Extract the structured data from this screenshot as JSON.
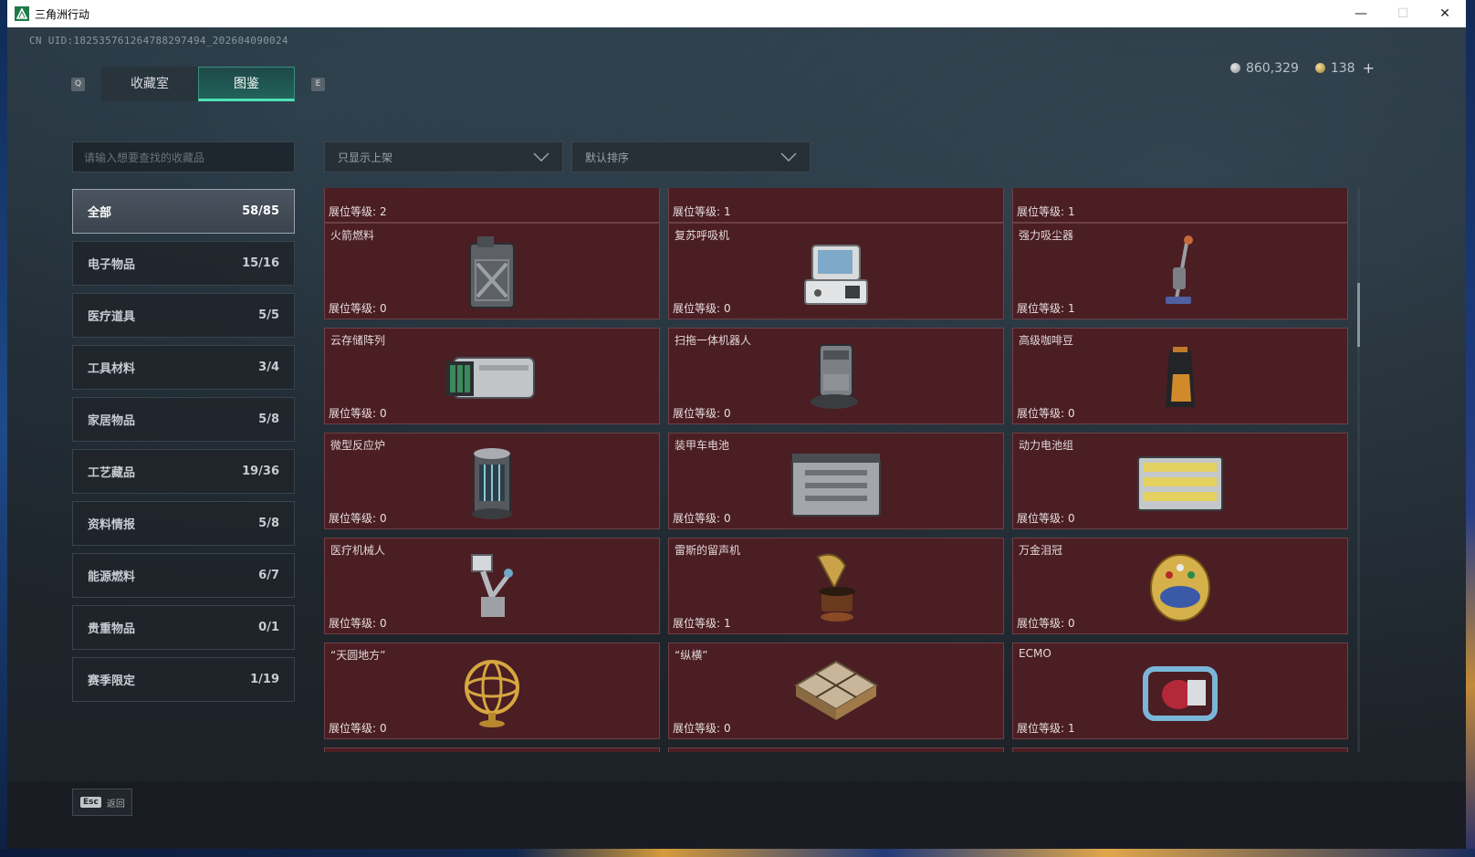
{
  "window": {
    "title": "三角洲行动",
    "minimize": "—",
    "maximize": "☐",
    "close": "✕"
  },
  "uid": "CN UID:18253576126478829749​4_202604090024",
  "currency": {
    "silver_amount": "860,329",
    "gold_amount": "138",
    "plus": "+"
  },
  "tabs": {
    "key_left": "Q",
    "key_right": "E",
    "items": [
      {
        "label": "收藏室"
      },
      {
        "label": "图鉴"
      }
    ]
  },
  "search": {
    "placeholder": "请输入想要查找的收藏品"
  },
  "filters": {
    "display_filter": "只显示上架",
    "sort": "默认排序"
  },
  "categories": [
    {
      "label": "全部",
      "count": "58/85"
    },
    {
      "label": "电子物品",
      "count": "15/16"
    },
    {
      "label": "医疗道具",
      "count": "5/5"
    },
    {
      "label": "工具材料",
      "count": "3/4"
    },
    {
      "label": "家居物品",
      "count": "5/8"
    },
    {
      "label": "工艺藏品",
      "count": "19/36"
    },
    {
      "label": "资料情报",
      "count": "5/8"
    },
    {
      "label": "能源燃料",
      "count": "6/7"
    },
    {
      "label": "贵重物品",
      "count": "0/1"
    },
    {
      "label": "赛季限定",
      "count": "1/19"
    }
  ],
  "level_label": "展位等级:",
  "items": [
    {
      "name": "",
      "level": "2",
      "icon": "partial-item-icon"
    },
    {
      "name": "",
      "level": "1",
      "icon": "partial-item-icon"
    },
    {
      "name": "",
      "level": "1",
      "icon": "partial-item-icon"
    },
    {
      "name": "火箭燃料",
      "level": "0",
      "icon": "rocket-fuel-icon"
    },
    {
      "name": "复苏呼吸机",
      "level": "0",
      "icon": "ventilator-icon"
    },
    {
      "name": "强力吸尘器",
      "level": "1",
      "icon": "vacuum-cleaner-icon"
    },
    {
      "name": "云存储阵列",
      "level": "0",
      "icon": "storage-array-icon"
    },
    {
      "name": "扫拖一体机器人",
      "level": "0",
      "icon": "mop-robot-icon"
    },
    {
      "name": "高级咖啡豆",
      "level": "0",
      "icon": "coffee-bean-icon"
    },
    {
      "name": "微型反应炉",
      "level": "0",
      "icon": "reactor-icon"
    },
    {
      "name": "装甲车电池",
      "level": "0",
      "icon": "vehicle-battery-icon"
    },
    {
      "name": "动力电池组",
      "level": "0",
      "icon": "battery-pack-icon"
    },
    {
      "name": "医疗机械人",
      "level": "0",
      "icon": "medical-robot-icon"
    },
    {
      "name": "雷斯的留声机",
      "level": "1",
      "icon": "gramophone-icon"
    },
    {
      "name": "万金泪冠",
      "level": "0",
      "icon": "jeweled-egg-icon"
    },
    {
      "name": "“天圆地方”",
      "level": "0",
      "icon": "armillary-sphere-icon"
    },
    {
      "name": "“纵横”",
      "level": "0",
      "icon": "chessboard-icon"
    },
    {
      "name": "ECMO",
      "level": "1",
      "icon": "ecmo-icon"
    }
  ],
  "footer": {
    "esc_key": "Esc",
    "back_label": "返回"
  },
  "colors": {
    "accent": "#4fe0b6",
    "card_bg": "#4a1e23",
    "card_border": "#6e4046"
  }
}
